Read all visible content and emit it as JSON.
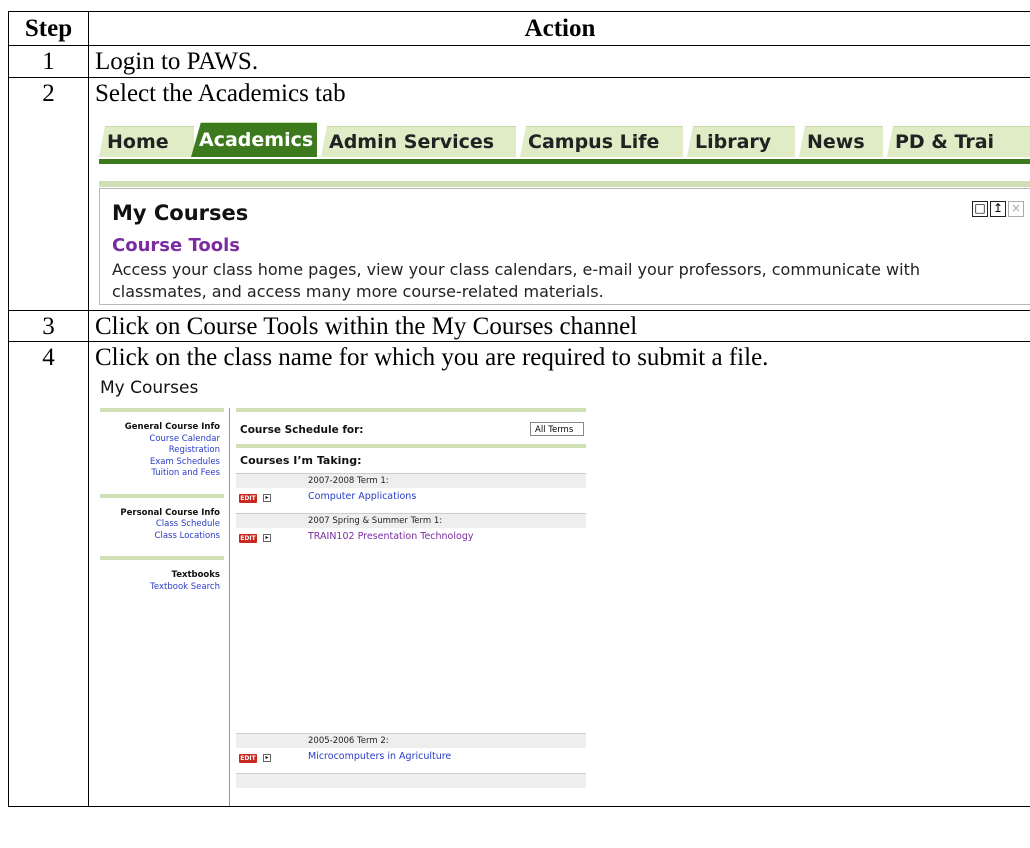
{
  "table": {
    "header_step": "Step",
    "header_action": "Action",
    "rows": [
      {
        "num": "1",
        "text": "Login to PAWS."
      },
      {
        "num": "2",
        "text": "Select the Academics tab"
      },
      {
        "num": "3",
        "text": "Click on Course Tools within the My Courses channel"
      },
      {
        "num": "4",
        "text": "Click on the class name for which you are required to submit a file."
      }
    ]
  },
  "tabs_shot": {
    "tabs": [
      "Home",
      "Academics",
      "Admin Services",
      "Campus Life",
      "Library",
      "News",
      "PD & Trai"
    ],
    "channel_title": "My Courses",
    "link": "Course Tools",
    "description": "Access your class home pages, view your class calendars, e-mail your professors, communicate with classmates, and access many more course-related materials.",
    "icons": [
      "maximize-icon",
      "focus-icon",
      "close-icon"
    ]
  },
  "courses_shot": {
    "heading": "My Courses",
    "sidebar": [
      {
        "head": "General Course Info",
        "links": [
          "Course Calendar",
          "Registration",
          "Exam Schedules",
          "Tuition and Fees"
        ]
      },
      {
        "head": "Personal Course Info",
        "links": [
          "Class Schedule",
          "Class Locations"
        ]
      },
      {
        "head": "Textbooks",
        "links": [
          "Textbook Search"
        ]
      }
    ],
    "schedule_label": "Course Schedule for:",
    "term_select": "All Terms",
    "taking_label": "Courses I’m Taking:",
    "edit_label": "EDIT",
    "terms": [
      {
        "term": "2007-2008 Term 1:",
        "course": "Computer Applications"
      },
      {
        "term": "2007 Spring & Summer Term 1:",
        "course": "TRAIN102 Presentation Technology"
      },
      {
        "term": "2005-2006 Term 2:",
        "course": "Microcomputers in Agriculture"
      }
    ]
  }
}
